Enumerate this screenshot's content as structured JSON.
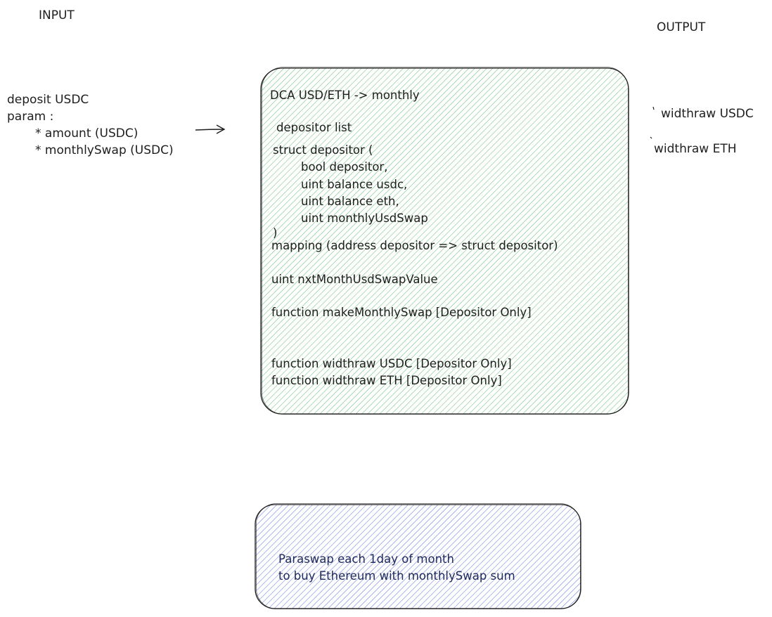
{
  "labels": {
    "input": "INPUT",
    "output": "OUTPUT"
  },
  "input_box": {
    "line1": "deposit USDC",
    "line2": "param :",
    "line3": "* amount (USDC)",
    "line4": "* monthlySwap (USDC)"
  },
  "output_items": {
    "item1": "widthraw USDC",
    "item2": "widthraw ETH"
  },
  "contract_box": {
    "title": "DCA USD/ETH -> monthly",
    "list_label": "depositor list",
    "struct_open": "struct depositor (",
    "field1": "bool depositor,",
    "field2": "uint balance usdc,",
    "field3": "uint balance eth,",
    "field4": "uint monthlyUsdSwap",
    "struct_close": ")",
    "mapping": "mapping (address depositor => struct depositor)",
    "variable": "uint nxtMonthUsdSwapValue",
    "func1": "function makeMonthlySwap [Depositor Only]",
    "func2": "function widthraw USDC [Depositor Only]",
    "func3": "function widthraw ETH [Depositor Only]"
  },
  "paraswap_box": {
    "line1": "Paraswap each 1day of month",
    "line2": "to buy Ethereum with monthlySwap sum"
  },
  "colors": {
    "stroke": "#1e1e1e",
    "green_hatch": "#6cc07a",
    "blue_hatch": "#6a7fe0"
  }
}
